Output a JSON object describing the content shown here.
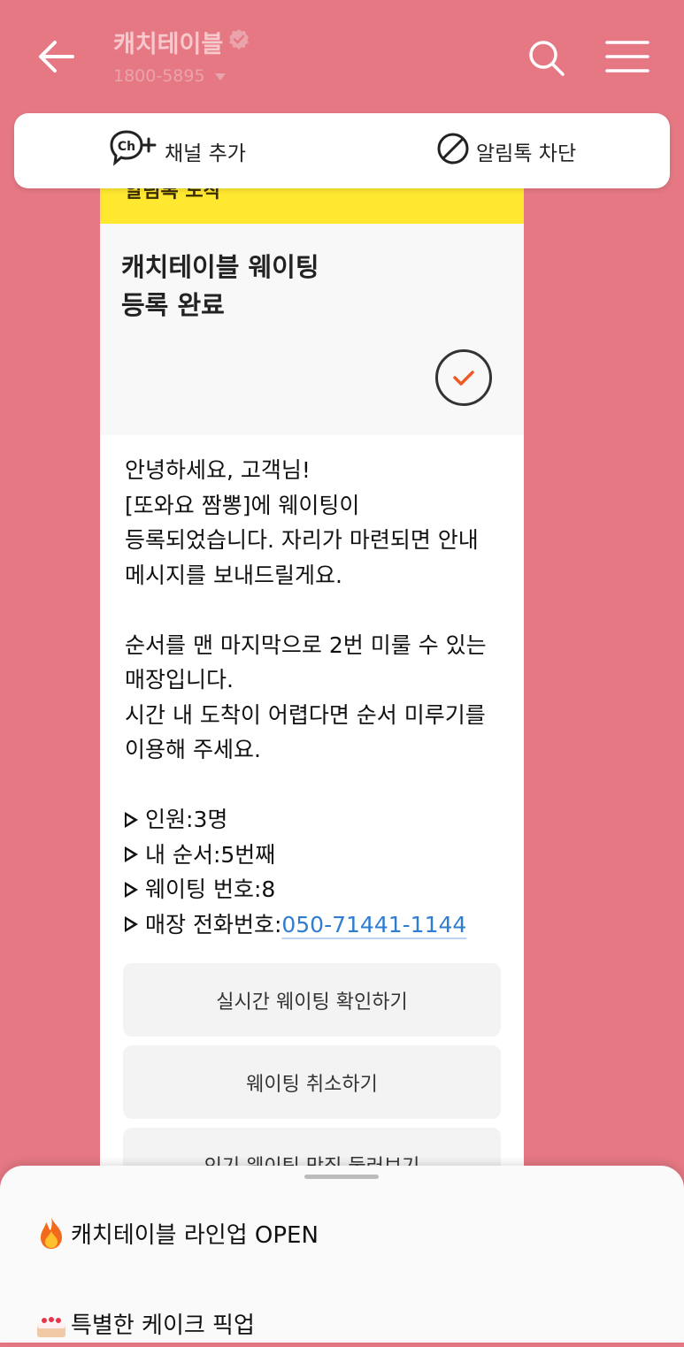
{
  "header": {
    "channel_name": "캐치테이블",
    "phone": "1800-5895"
  },
  "action_bar": {
    "add_channel_label": "채널 추가",
    "ch_badge": "Ch",
    "block_label": "알림톡 차단"
  },
  "message": {
    "header_label": "알림톡 도착",
    "title": "캐치테이블 웨이팅\n등록 완료",
    "greeting": "안녕하세요, 고객님!\n[또와요 짬뽕]에 웨이팅이\n등록되었습니다. 자리가 마련되면 안내\n메시지를 보내드릴게요.",
    "notice": "순서를 맨 마지막으로 2번 미룰 수 있는\n매장입니다.\n시간 내 도착이 어렵다면 순서 미루기를\n이용해 주세요.",
    "info": {
      "party_label": "인원: ",
      "party_value": "3명",
      "order_label": "내 순서: ",
      "order_value": "5번째",
      "waiting_no_label": "웨이팅 번호: ",
      "waiting_no_value": "8",
      "store_phone_label": "매장 전화번호: ",
      "store_phone_value": "050-71441-1144"
    },
    "buttons": {
      "realtime": "실시간 웨이팅 확인하기",
      "cancel": "웨이팅 취소하기",
      "third_partial": "인기 웨이팅 맛집 둘러보기"
    }
  },
  "bottom_sheet": {
    "items": [
      {
        "icon": "fire-emoji",
        "label": "캐치테이블 라인업 OPEN"
      },
      {
        "icon": "cake-emoji",
        "label": "특별한 케이크 픽업"
      }
    ]
  },
  "colors": {
    "background": "#e57883",
    "accent_yellow": "#ffe82f",
    "link_blue": "#2f7dd1",
    "check_orange": "#ee5a24"
  }
}
